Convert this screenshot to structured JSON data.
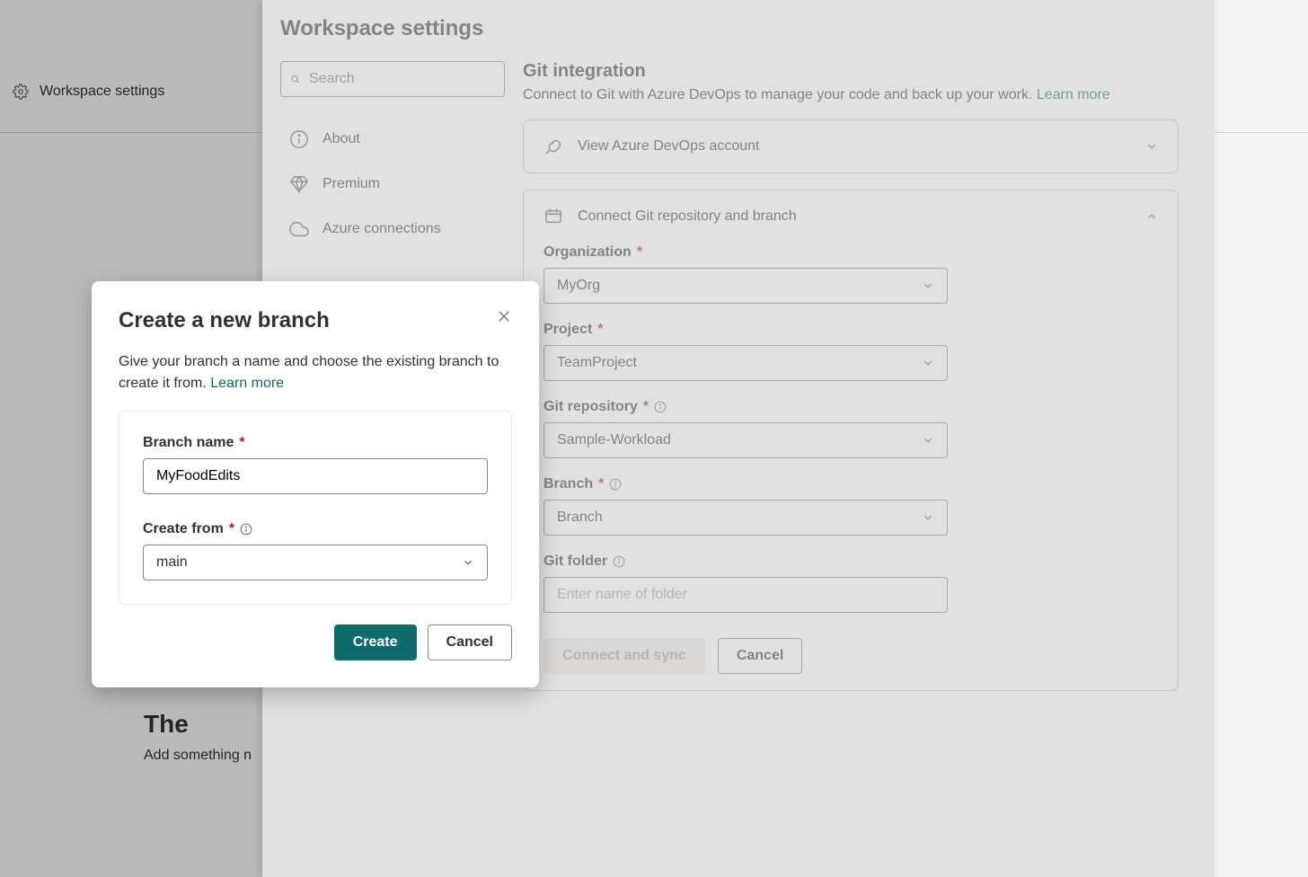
{
  "app": {
    "title": "Workspace settings"
  },
  "bgEmpty": {
    "title": "The",
    "sub": "Add something n"
  },
  "panel": {
    "title": "Workspace settings",
    "search": {
      "placeholder": "Search"
    },
    "nav": {
      "about": "About",
      "premium": "Premium",
      "azure": "Azure connections"
    }
  },
  "git": {
    "title": "Git integration",
    "subtitle": "Connect to Git with Azure DevOps to manage your code and back up your work. ",
    "learn": "Learn more",
    "viewAccount": "View Azure DevOps account",
    "connectRepo": "Connect Git repository and branch",
    "fields": {
      "org": {
        "label": "Organization",
        "value": "MyOrg"
      },
      "project": {
        "label": "Project",
        "value": "TeamProject"
      },
      "repo": {
        "label": "Git repository",
        "value": "Sample-Workload"
      },
      "branch": {
        "label": "Branch",
        "value": "Branch"
      },
      "folder": {
        "label": "Git folder",
        "placeholder": "Enter name of folder"
      }
    },
    "buttons": {
      "connect": "Connect and sync",
      "cancel": "Cancel"
    }
  },
  "modal": {
    "title": "Create a new branch",
    "desc": "Give your branch a name and choose the existing branch to create it from. ",
    "learn": "Learn more",
    "branchName": {
      "label": "Branch name",
      "value": "MyFoodEdits"
    },
    "createFrom": {
      "label": "Create from",
      "value": "main"
    },
    "buttons": {
      "create": "Create",
      "cancel": "Cancel"
    }
  }
}
